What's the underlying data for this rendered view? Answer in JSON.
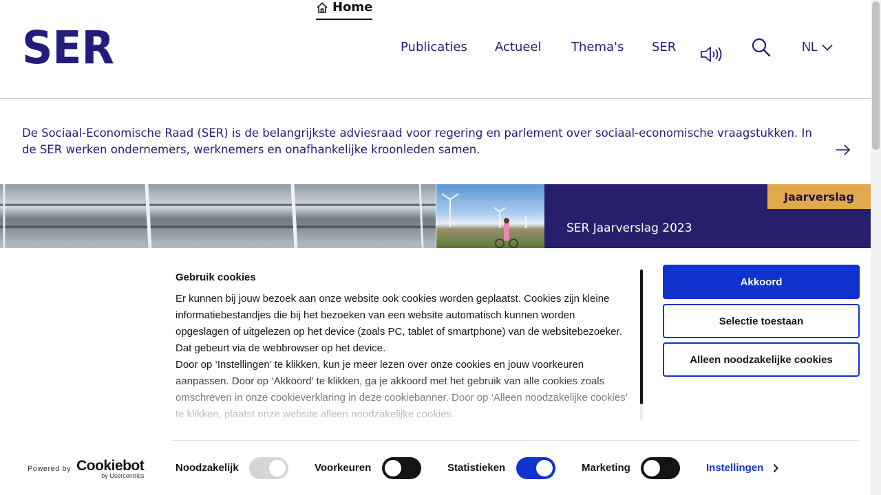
{
  "logo": {
    "text": "SER",
    "color": "#231c7a"
  },
  "nav": {
    "home": "Home",
    "items": [
      "Publicaties",
      "Actueel",
      "Thema's",
      "SER"
    ],
    "language": "NL"
  },
  "intro": {
    "text": "De Sociaal-Economische Raad (SER) is de belangrijkste adviesraad voor regering en parlement over sociaal-economische vraagstukken. In de SER werken ondernemers, werknemers en onafhankelijke kroonleden samen."
  },
  "hero": {
    "badge": "Jaarverslag",
    "title": "SER Jaarverslag 2023"
  },
  "cookie": {
    "title": "Gebruik cookies",
    "paragraph1": "Er kunnen bij jouw bezoek aan onze website ook cookies worden geplaatst. Cookies zijn kleine informatiebestandjes die bij het bezoeken van een website automatisch kunnen worden opgeslagen of uitgelezen op het device (zoals PC, tablet of smartphone) van de websitebezoeker. Dat gebeurt via de webbrowser op het device.",
    "paragraph2": "Door op ‘Instellingen’ te klikken, kun je meer lezen over onze cookies en jouw voorkeuren aanpassen. Door op ‘Akkoord’ te klikken, ga je akkoord met het gebruik van alle cookies zoals omschreven in onze cookieverklaring in deze cookiebanner. Door op ‘Alleen noodzakelijke cookies’ te klikken, plaatst onze website alleen noodzakelijke cookies.",
    "buttons": {
      "accept": "Akkoord",
      "selection": "Selectie toestaan",
      "necessary_only": "Alleen noodzakelijke cookies"
    },
    "toggles": [
      {
        "label": "Noodzakelijk",
        "state": "on-disabled"
      },
      {
        "label": "Voorkeuren",
        "state": "off"
      },
      {
        "label": "Statistieken",
        "state": "on"
      },
      {
        "label": "Marketing",
        "state": "off"
      }
    ],
    "settings_link": "Instellingen",
    "powered_by": "Powered by",
    "brand": "Cookiebot",
    "brand_sub": "by Usercentrics"
  },
  "colors": {
    "primary": "#231c7a",
    "accent_blue": "#1032cf",
    "badge": "#e0a94b",
    "toggle_off": "#141414",
    "toggle_disabled": "#d6d6d6"
  },
  "icons": [
    "home-icon",
    "audio-icon",
    "search-icon",
    "chevron-down-icon",
    "arrow-right-icon",
    "chevron-right-icon"
  ]
}
